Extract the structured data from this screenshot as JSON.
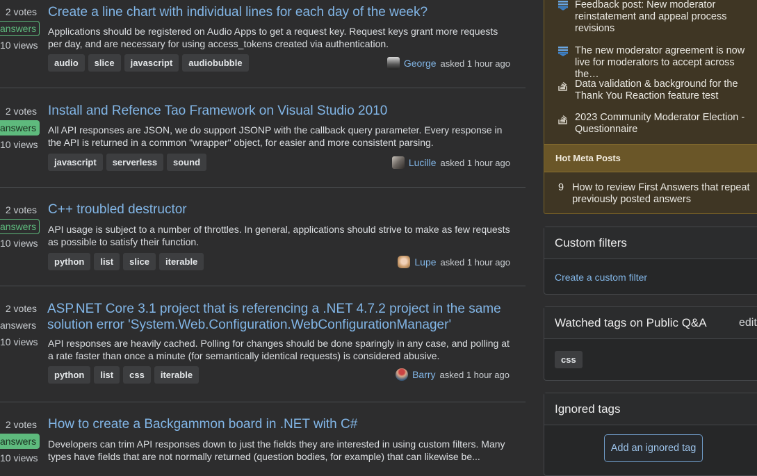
{
  "colors": {
    "background": "#2d2d2e",
    "link": "#82b6e7",
    "answer_green": "#5eba7d",
    "meta_box_bg": "#3f3624",
    "meta_header_bg": "#6a5628"
  },
  "questions": [
    {
      "votes": "2 votes",
      "answers": "answers",
      "answers_style": "outline",
      "views": "10 views",
      "title": "Create a line chart with individual lines for each day of the week?",
      "excerpt": "Applications should be registered on Audio Apps to get a request key. Request keys grant more requests per day, and are necessary for using access_tokens created via authentication.",
      "tags": [
        "audio",
        "slice",
        "javascript",
        "audiobubble"
      ],
      "author": "George",
      "asked": "asked 1 hour ago"
    },
    {
      "votes": "2 votes",
      "answers": "answers",
      "answers_style": "filled",
      "views": "10 views",
      "title": "Install and Refence Tao Framework on Visual Studio 2010",
      "excerpt": "All API responses are JSON, we do support JSONP with the callback query parameter. Every response in the API is returned in a common \"wrapper\" object, for easier and more consistent parsing.",
      "tags": [
        "javascript",
        "serverless",
        "sound"
      ],
      "author": "Lucille",
      "asked": "asked 1 hour ago"
    },
    {
      "votes": "2 votes",
      "answers": "answers",
      "answers_style": "outline",
      "views": "10 views",
      "title": "C++ troubled destructor",
      "excerpt": "API usage is subject to a number of throttles. In general, applications should strive to make as few requests as possible to satisfy their function.",
      "tags": [
        "python",
        "list",
        "slice",
        "iterable"
      ],
      "author": "Lupe",
      "asked": "asked 1 hour ago"
    },
    {
      "votes": "2 votes",
      "answers": "answers",
      "answers_style": "plain",
      "views": "10 views",
      "title": "ASP.NET Core 3.1 project that is referencing a .NET 4.7.2 project in the same solution error 'System.Web.Configuration.WebConfigurationManager'",
      "excerpt": "API responses are heavily cached. Polling for changes should be done sparingly in any case, and polling at a rate faster than once a minute (for semantically identical requests) is considered abusive.",
      "tags": [
        "python",
        "list",
        "css",
        "iterable"
      ],
      "author": "Barry",
      "asked": "asked 1 hour ago"
    },
    {
      "votes": "2 votes",
      "answers": "answers",
      "answers_style": "filled",
      "views": "10 views",
      "title": "How to create a Backgammon board in .NET with C#",
      "excerpt": "Developers can trim API responses down to just the fields they are interested in using custom filters. Many types have fields that are not normally returned (question bodies, for example) that can likewise be...",
      "tags": [],
      "author": "",
      "asked": ""
    }
  ],
  "sidebar": {
    "meta_posts": [
      {
        "icon": "meta-post-icon",
        "text": "Feedback post: New moderator reinstatement and appeal process revisions"
      },
      {
        "icon": "meta-post-icon",
        "text": "The new moderator agreement is now live for moderators to accept across the…"
      },
      {
        "icon": "stack-logo-icon",
        "text": "Data validation & background for the Thank You Reaction feature test"
      },
      {
        "icon": "stack-logo-icon",
        "text": "2023 Community Moderator Election - Questionnaire"
      }
    ],
    "hot_meta_header": "Hot Meta Posts",
    "hot_meta_posts": [
      {
        "count": "9",
        "text": "How to review First Answers that repeat previously posted answers"
      }
    ],
    "custom_filters": {
      "title": "Custom filters",
      "link": "Create a custom filter"
    },
    "watched_tags": {
      "title": "Watched tags on Public Q&A",
      "edit": "edit",
      "tags": [
        "css"
      ]
    },
    "ignored_tags": {
      "title": "Ignored tags",
      "button": "Add an ignored tag"
    }
  }
}
